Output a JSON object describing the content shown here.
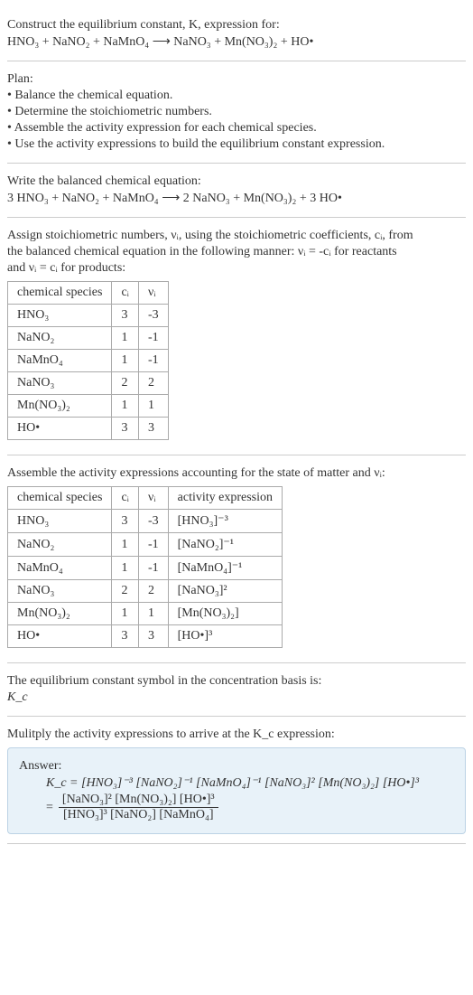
{
  "title": "Construct the equilibrium constant, K, expression for:",
  "reaction_unbalanced": "HNO₃ + NaNO₂ + NaMnO₄  ⟶  NaNO₃ + Mn(NO₃)₂ + HO•",
  "plan_heading": "Plan:",
  "plan_items": [
    "• Balance the chemical equation.",
    "• Determine the stoichiometric numbers.",
    "• Assemble the activity expression for each chemical species.",
    "• Use the activity expressions to build the equilibrium constant expression."
  ],
  "balanced_heading": "Write the balanced chemical equation:",
  "reaction_balanced": "3 HNO₃ + NaNO₂ + NaMnO₄  ⟶  2 NaNO₃ + Mn(NO₃)₂ + 3 HO•",
  "stoich_text1": "Assign stoichiometric numbers, νᵢ, using the stoichiometric coefficients, cᵢ, from",
  "stoich_text2": "the balanced chemical equation in the following manner: νᵢ = -cᵢ for reactants",
  "stoich_text3": "and νᵢ = cᵢ for products:",
  "stoich_table": {
    "headers": [
      "chemical species",
      "cᵢ",
      "νᵢ"
    ],
    "rows": [
      [
        "HNO₃",
        "3",
        "-3"
      ],
      [
        "NaNO₂",
        "1",
        "-1"
      ],
      [
        "NaMnO₄",
        "1",
        "-1"
      ],
      [
        "NaNO₃",
        "2",
        "2"
      ],
      [
        "Mn(NO₃)₂",
        "1",
        "1"
      ],
      [
        "HO•",
        "3",
        "3"
      ]
    ]
  },
  "activity_heading": "Assemble the activity expressions accounting for the state of matter and νᵢ:",
  "activity_table": {
    "headers": [
      "chemical species",
      "cᵢ",
      "νᵢ",
      "activity expression"
    ],
    "rows": [
      [
        "HNO₃",
        "3",
        "-3",
        "[HNO₃]⁻³"
      ],
      [
        "NaNO₂",
        "1",
        "-1",
        "[NaNO₂]⁻¹"
      ],
      [
        "NaMnO₄",
        "1",
        "-1",
        "[NaMnO₄]⁻¹"
      ],
      [
        "NaNO₃",
        "2",
        "2",
        "[NaNO₃]²"
      ],
      [
        "Mn(NO₃)₂",
        "1",
        "1",
        "[Mn(NO₃)₂]"
      ],
      [
        "HO•",
        "3",
        "3",
        "[HO•]³"
      ]
    ]
  },
  "kc_heading": "The equilibrium constant symbol in the concentration basis is:",
  "kc_symbol": "K_c",
  "multiply_heading": "Mulitply the activity expressions to arrive at the K_c expression:",
  "answer_label": "Answer:",
  "answer_line1": "K_c = [HNO₃]⁻³ [NaNO₂]⁻¹ [NaMnO₄]⁻¹ [NaNO₃]² [Mn(NO₃)₂] [HO•]³",
  "answer_frac_num": "[NaNO₃]² [Mn(NO₃)₂] [HO•]³",
  "answer_frac_den": "[HNO₃]³ [NaNO₂] [NaMnO₄]",
  "answer_eq": "="
}
